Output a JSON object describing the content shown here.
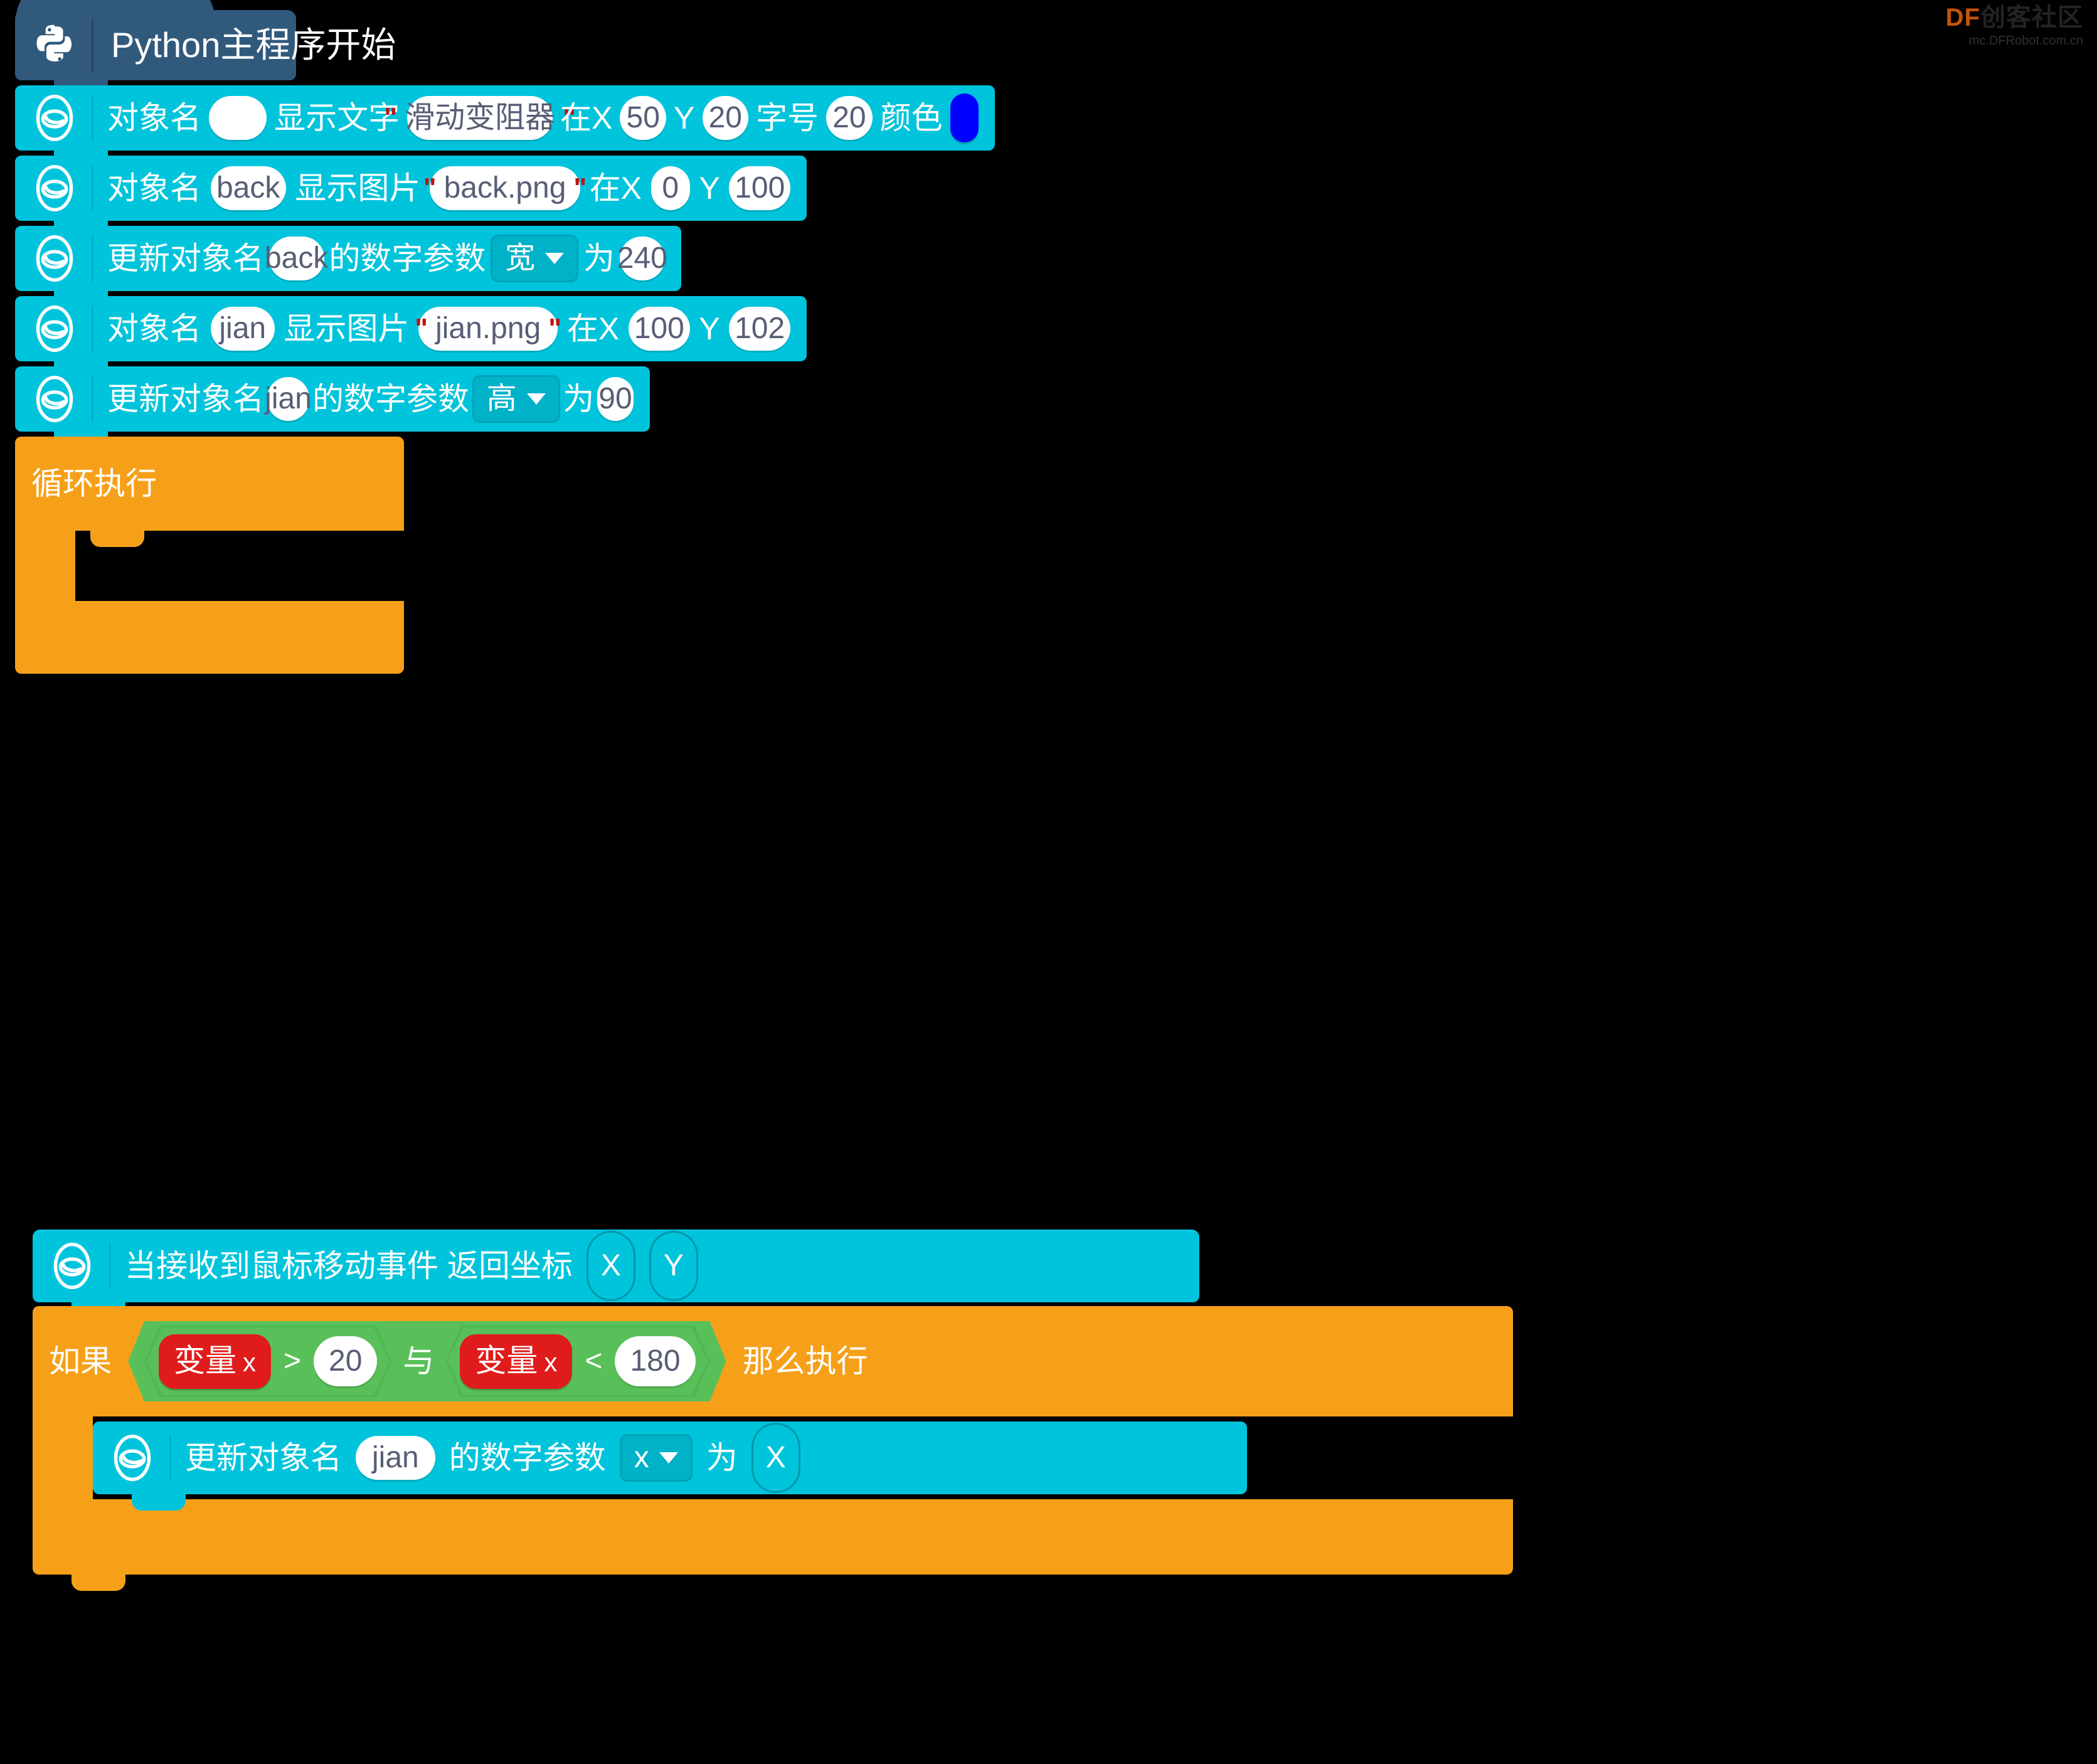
{
  "watermark": {
    "brand_df": "DF",
    "brand_cn": "创客社区",
    "url": "mc.DFRobot.com.cn"
  },
  "colors": {
    "hat": "#31597c",
    "statement": "#00c4db",
    "control": "#f6a01a",
    "operator": "#59c059",
    "variable": "#e01b1b",
    "field_text": "#575e75",
    "text_color_swatch": "#0000ff"
  },
  "script_main": {
    "hat": {
      "icon": "python-logo-icon",
      "label": "Python主程序开始"
    },
    "blocks": [
      {
        "icon": "display-object-icon",
        "parts": [
          {
            "type": "label",
            "text": "对象名"
          },
          {
            "type": "field_blank",
            "value": ""
          },
          {
            "type": "label",
            "text": "显示文字"
          },
          {
            "type": "field_string",
            "value": "滑动变阻器"
          },
          {
            "type": "label",
            "text": "在X"
          },
          {
            "type": "field_number",
            "value": "50"
          },
          {
            "type": "label",
            "text": "Y"
          },
          {
            "type": "field_number",
            "value": "20"
          },
          {
            "type": "label",
            "text": "字号"
          },
          {
            "type": "field_number",
            "value": "20"
          },
          {
            "type": "label",
            "text": "颜色"
          },
          {
            "type": "field_color",
            "value": "#0000ff"
          }
        ]
      },
      {
        "icon": "display-object-icon",
        "parts": [
          {
            "type": "label",
            "text": "对象名"
          },
          {
            "type": "field_text",
            "value": "back"
          },
          {
            "type": "label",
            "text": "显示图片"
          },
          {
            "type": "field_string",
            "value": "back.png"
          },
          {
            "type": "label",
            "text": "在X"
          },
          {
            "type": "field_number",
            "value": "0"
          },
          {
            "type": "label",
            "text": "Y"
          },
          {
            "type": "field_number",
            "value": "100"
          }
        ]
      },
      {
        "icon": "display-object-icon",
        "parts": [
          {
            "type": "label",
            "text": "更新对象名"
          },
          {
            "type": "field_text",
            "value": "back"
          },
          {
            "type": "label",
            "text": "的数字参数"
          },
          {
            "type": "dropdown",
            "value": "宽"
          },
          {
            "type": "label",
            "text": "为"
          },
          {
            "type": "field_number",
            "value": "240"
          }
        ]
      },
      {
        "icon": "display-object-icon",
        "parts": [
          {
            "type": "label",
            "text": "对象名"
          },
          {
            "type": "field_text",
            "value": "jian"
          },
          {
            "type": "label",
            "text": "显示图片"
          },
          {
            "type": "field_string",
            "value": "jian.png"
          },
          {
            "type": "label",
            "text": "在X"
          },
          {
            "type": "field_number",
            "value": "100"
          },
          {
            "type": "label",
            "text": "Y"
          },
          {
            "type": "field_number",
            "value": "102"
          }
        ]
      },
      {
        "icon": "display-object-icon",
        "parts": [
          {
            "type": "label",
            "text": "更新对象名"
          },
          {
            "type": "field_text",
            "value": "jian"
          },
          {
            "type": "label",
            "text": "的数字参数"
          },
          {
            "type": "dropdown",
            "value": "高"
          },
          {
            "type": "label",
            "text": "为"
          },
          {
            "type": "field_number",
            "value": "90"
          }
        ]
      }
    ],
    "loop": {
      "label": "循环执行",
      "body": []
    }
  },
  "script_event": {
    "hat": {
      "icon": "display-object-icon",
      "label": "当接收到鼠标移动事件 返回坐标",
      "params": [
        "X",
        "Y"
      ]
    },
    "if_block": {
      "if_label": "如果",
      "then_label": "那么执行",
      "condition": {
        "operator": "and",
        "operator_label": "与",
        "left": {
          "variable_label": "变量",
          "variable_name": "x",
          "comparator": ">",
          "value": "20"
        },
        "right": {
          "variable_label": "变量",
          "variable_name": "x",
          "comparator": "<",
          "value": "180"
        }
      },
      "body": [
        {
          "icon": "display-object-icon",
          "parts": [
            {
              "type": "label",
              "text": "更新对象名"
            },
            {
              "type": "field_text",
              "value": "jian"
            },
            {
              "type": "label",
              "text": "的数字参数"
            },
            {
              "type": "dropdown",
              "value": "x"
            },
            {
              "type": "label",
              "text": "为"
            },
            {
              "type": "var_reporter",
              "value": "X"
            }
          ]
        }
      ]
    }
  }
}
